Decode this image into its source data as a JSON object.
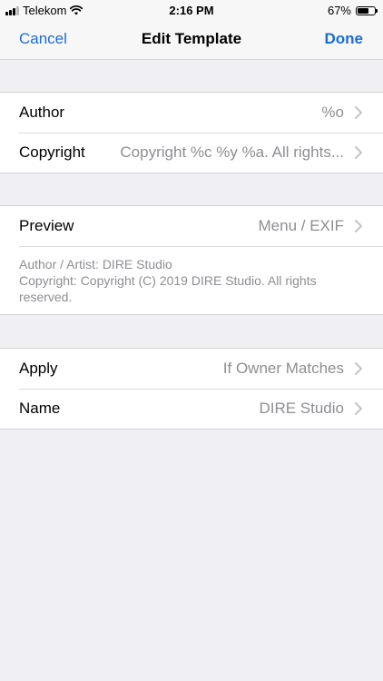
{
  "status_bar": {
    "carrier": "Telekom",
    "time": "2:16 PM",
    "battery": "67%",
    "battery_level": 0.67
  },
  "nav": {
    "cancel_label": "Cancel",
    "title": "Edit Template",
    "done_label": "Done"
  },
  "metadata_group": {
    "rows": [
      {
        "label": "Author",
        "value": "%o"
      },
      {
        "label": "Copyright",
        "value": "Copyright %c %y %a. All rights..."
      }
    ]
  },
  "preview_group": {
    "label": "Preview",
    "value": "Menu / EXIF",
    "lines": [
      "Author / Artist: DIRE Studio",
      "Copyright: Copyright (C) 2019 DIRE Studio. All rights reserved."
    ]
  },
  "apply_group": {
    "rows": [
      {
        "label": "Apply",
        "value": "If Owner Matches"
      },
      {
        "label": "Name",
        "value": "DIRE Studio"
      }
    ]
  },
  "icons": {
    "signal": "signal-bars-icon",
    "wifi": "wifi-icon",
    "battery": "battery-icon",
    "disclosure": "chevron-right-icon"
  },
  "colors": {
    "accent": "#1c6cd6",
    "secondary_text": "#8e8e93",
    "background": "#efeff4"
  }
}
